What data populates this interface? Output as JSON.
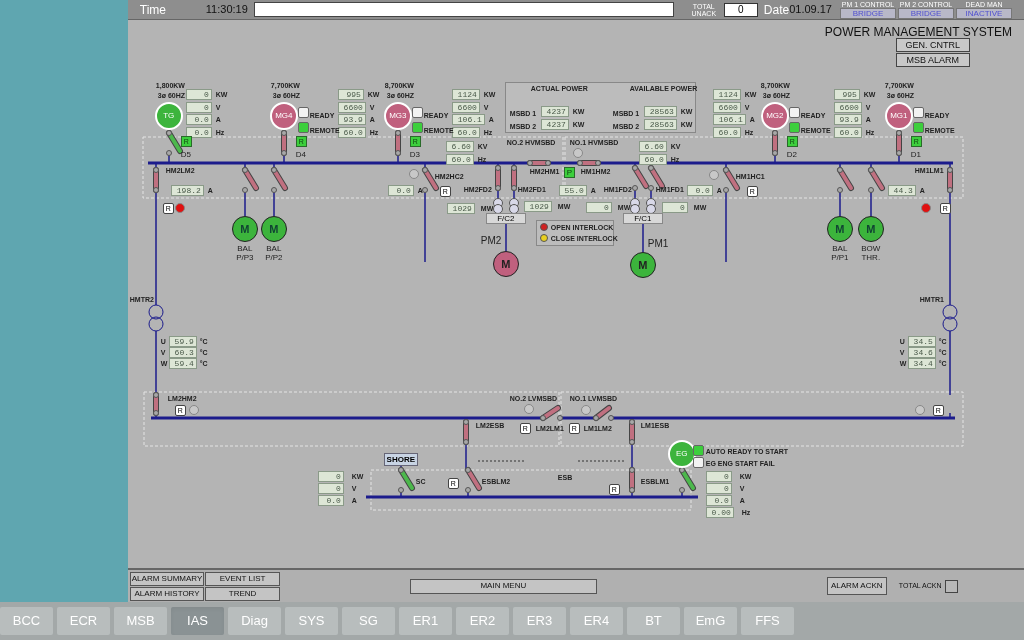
{
  "header": {
    "time_label": "Time",
    "time": "11:30:19",
    "unack_label": "TOTAL UNACK",
    "unack_count": "0",
    "date_label": "Date",
    "date": "01.09.17",
    "controls": [
      {
        "label": "PM 1 CONTROL",
        "value": "BRIDGE"
      },
      {
        "label": "PM 2 CONTROL",
        "value": "BRIDGE"
      },
      {
        "label": "DEAD MAN",
        "value": "INACTIVE"
      }
    ]
  },
  "title": "POWER MANAGEMENT SYSTEM",
  "top_buttons": [
    "GEN. CNTRL",
    "MSB ALARM"
  ],
  "generators": [
    {
      "name": "TG",
      "rating": "1,800KW",
      "spec": "3ø 60HZ",
      "color": "#3cb43c",
      "readings": [
        {
          "value": "0",
          "unit": "KW"
        },
        {
          "value": "0",
          "unit": "V"
        },
        {
          "value": "0.0",
          "unit": "A"
        },
        {
          "value": "0.0",
          "unit": "Hz"
        }
      ],
      "mode": "R",
      "breaker": {
        "label": "D5",
        "closed": false,
        "color": "#4cb84c"
      }
    },
    {
      "name": "MG4",
      "rating": "7,700KW",
      "spec": "3ø 60HZ",
      "color": "#c0607e",
      "readings": [
        {
          "value": "995",
          "unit": "KW"
        },
        {
          "value": "6600",
          "unit": "V"
        },
        {
          "value": "93.9",
          "unit": "A"
        },
        {
          "value": "60.0",
          "unit": "Hz"
        }
      ],
      "status": [
        {
          "label": "READY",
          "on": false
        },
        {
          "label": "REMOTE",
          "on": true
        }
      ],
      "mode": "R",
      "breaker": {
        "label": "D4",
        "closed": true,
        "color": "#c07080"
      }
    },
    {
      "name": "MG3",
      "rating": "8,700KW",
      "spec": "3ø 60HZ",
      "color": "#c0607e",
      "readings": [
        {
          "value": "1124",
          "unit": "KW"
        },
        {
          "value": "6600",
          "unit": "V"
        },
        {
          "value": "106.1",
          "unit": "A"
        },
        {
          "value": "60.0",
          "unit": "Hz"
        }
      ],
      "status": [
        {
          "label": "READY",
          "on": false
        },
        {
          "label": "REMOTE",
          "on": true
        }
      ],
      "mode": "R",
      "breaker": {
        "label": "D3",
        "closed": true,
        "color": "#c07080"
      }
    },
    {
      "name": "MG2",
      "rating": "8,700KW",
      "spec": "3ø 60HZ",
      "color": "#c0607e",
      "readings": [
        {
          "value": "1124",
          "unit": "KW"
        },
        {
          "value": "6600",
          "unit": "V"
        },
        {
          "value": "106.1",
          "unit": "A"
        },
        {
          "value": "60.0",
          "unit": "Hz"
        }
      ],
      "status": [
        {
          "label": "READY",
          "on": false
        },
        {
          "label": "REMOTE",
          "on": true
        }
      ],
      "mode": "R",
      "breaker": {
        "label": "D2",
        "closed": true,
        "color": "#c07080"
      }
    },
    {
      "name": "MG1",
      "rating": "7,700KW",
      "spec": "3ø 60HZ",
      "color": "#c0607e",
      "readings": [
        {
          "value": "995",
          "unit": "KW"
        },
        {
          "value": "6600",
          "unit": "V"
        },
        {
          "value": "93.9",
          "unit": "A"
        },
        {
          "value": "60.0",
          "unit": "Hz"
        }
      ],
      "status": [
        {
          "label": "READY",
          "on": false
        },
        {
          "label": "REMOTE",
          "on": true
        }
      ],
      "mode": "R",
      "breaker": {
        "label": "D1",
        "closed": true,
        "color": "#c07080"
      }
    }
  ],
  "power_summary": {
    "actual_title": "ACTUAL POWER",
    "available_title": "AVAILABLE POWER",
    "actual": [
      {
        "label": "MSBD 1",
        "value": "4237",
        "unit": "KW"
      },
      {
        "label": "MSBD 2",
        "value": "4237",
        "unit": "KW"
      }
    ],
    "available": [
      {
        "label": "MSBD 1",
        "value": "28563",
        "unit": "KW"
      },
      {
        "label": "MSBD 2",
        "value": "28563",
        "unit": "KW"
      }
    ]
  },
  "hv_boards": [
    {
      "name": "NO.2 HVMSBD",
      "readings": [
        {
          "value": "6.60",
          "unit": "KV"
        },
        {
          "value": "60.0",
          "unit": "Hz"
        }
      ]
    },
    {
      "name": "NO.1 HVMSBD",
      "readings": [
        {
          "value": "6.60",
          "unit": "KV"
        },
        {
          "value": "60.0",
          "unit": "Hz"
        }
      ]
    }
  ],
  "bus_tie_mode": "P",
  "breakers": [
    {
      "label": "HM2LM2",
      "closed": true,
      "color": "#c07080"
    },
    {
      "label": "HM2HC2",
      "closed": false,
      "color": "#c07080"
    },
    {
      "label": "HM2FD2",
      "closed": true,
      "color": "#c07080"
    },
    {
      "label": "HM2FD1",
      "closed": true,
      "color": "#c07080"
    },
    {
      "label": "HM2HM1",
      "closed": true,
      "color": "#c07080"
    },
    {
      "label": "HM1HM2",
      "closed": true,
      "color": "#c07080"
    },
    {
      "label": "HM1FD2",
      "closed": false,
      "color": "#c07080"
    },
    {
      "label": "HM1FD1",
      "closed": false,
      "color": "#c07080"
    },
    {
      "label": "HM1HC1",
      "closed": false,
      "color": "#c07080"
    },
    {
      "label": "HM1LM1",
      "closed": true,
      "color": "#c07080"
    },
    {
      "label": "LM2HM2",
      "closed": true,
      "color": "#c07080"
    },
    {
      "label": "LM2LM1",
      "closed": false,
      "color": "#c07080"
    },
    {
      "label": "LM1LM2",
      "closed": false,
      "color": "#c07080"
    },
    {
      "label": "LM2ESB",
      "closed": true,
      "color": "#c07080"
    },
    {
      "label": "LM1ESB",
      "closed": true,
      "color": "#c07080"
    },
    {
      "label": "SC",
      "closed": false,
      "color": "#4cb84c"
    },
    {
      "label": "ESBLM2",
      "closed": false,
      "color": "#c07080"
    },
    {
      "label": "ESBLM1",
      "closed": true,
      "color": "#c07080"
    }
  ],
  "currents": [
    {
      "value": "198.2",
      "unit": "A"
    },
    {
      "value": "0.0",
      "unit": "A"
    },
    {
      "value": "55.0",
      "unit": "A"
    },
    {
      "value": "0.0",
      "unit": "A"
    },
    {
      "value": "44.3",
      "unit": "A"
    }
  ],
  "loads": [
    {
      "label": "BAL P/P3",
      "symbol": "M",
      "color": "#3cb43c",
      "closed": false
    },
    {
      "label": "BAL P/P2",
      "symbol": "M",
      "color": "#3cb43c",
      "closed": false
    },
    {
      "label": "BAL P/P1",
      "symbol": "M",
      "color": "#3cb43c",
      "closed": false
    },
    {
      "label": "BOW THR.",
      "symbol": "M",
      "color": "#3cb43c",
      "closed": false
    }
  ],
  "propulsion": [
    {
      "name": "PM2",
      "converter": "F/C2",
      "symbol": "M",
      "color": "#c0607e",
      "power": [
        {
          "value": "1029",
          "unit": "MW"
        },
        {
          "value": "1029",
          "unit": "MW"
        }
      ]
    },
    {
      "name": "PM1",
      "converter": "F/C1",
      "symbol": "M",
      "color": "#3cb43c",
      "power": [
        {
          "value": "0",
          "unit": "MW"
        },
        {
          "value": "0",
          "unit": "MW"
        }
      ]
    }
  ],
  "interlocks": [
    {
      "label": "OPEN INTERLOCK",
      "color": "#d02020"
    },
    {
      "label": "CLOSE INTERLOCK",
      "color": "#e8d020"
    }
  ],
  "lamps": [
    {
      "color": "#c8c8c8"
    },
    {
      "color": "#c8c8c8"
    },
    {
      "color": "#c8c8c8"
    },
    {
      "color": "#e01010"
    },
    {
      "color": "#e01010"
    },
    {
      "color": "#c8c8c8"
    },
    {
      "color": "#c8c8c8"
    },
    {
      "color": "#c8c8c8"
    },
    {
      "color": "#c8c8c8"
    }
  ],
  "reset_buttons": [
    "R",
    "R",
    "R",
    "R",
    "R",
    "R",
    "R",
    "R",
    "R",
    "R"
  ],
  "transformers": [
    {
      "name": "HMTR2",
      "temps": [
        {
          "phase": "U",
          "value": "59.9",
          "unit": "°C"
        },
        {
          "phase": "V",
          "value": "60.3",
          "unit": "°C"
        },
        {
          "phase": "W",
          "value": "59.4",
          "unit": "°C"
        }
      ]
    },
    {
      "name": "HMTR1",
      "temps": [
        {
          "phase": "U",
          "value": "34.5",
          "unit": "°C"
        },
        {
          "phase": "V",
          "value": "34.6",
          "unit": "°C"
        },
        {
          "phase": "W",
          "value": "34.4",
          "unit": "°C"
        }
      ]
    }
  ],
  "lv_boards": [
    "NO.2 LVMSBD",
    "NO.1 LVMSBD"
  ],
  "esb": {
    "name": "ESB",
    "shore_button": "SHORE",
    "shore_readings": [
      {
        "value": "0",
        "unit": "KW"
      },
      {
        "value": "0",
        "unit": "V"
      },
      {
        "value": "0.0",
        "unit": "A"
      }
    ]
  },
  "eg": {
    "name": "EG",
    "color": "#3cb43c",
    "breaker_closed": false,
    "status": [
      {
        "label": "AUTO READY TO START",
        "on": true
      },
      {
        "label": "EG ENG START FAIL",
        "on": false
      }
    ],
    "readings": [
      {
        "value": "0",
        "unit": "KW"
      },
      {
        "value": "0",
        "unit": "V"
      },
      {
        "value": "0.0",
        "unit": "A"
      },
      {
        "value": "0.00",
        "unit": "Hz"
      }
    ]
  },
  "bottom": {
    "alarm_buttons": [
      "ALARM SUMMARY",
      "EVENT LIST",
      "ALARM HISTORY",
      "TREND"
    ],
    "main_menu": "MAIN MENU",
    "alarm_ackn": "ALARM ACKN",
    "total_ackn": {
      "label": "TOTAL ACKN",
      "checked": false
    }
  },
  "tabs": [
    {
      "label": "BCC",
      "selected": false
    },
    {
      "label": "ECR",
      "selected": false
    },
    {
      "label": "MSB",
      "selected": false
    },
    {
      "label": "IAS",
      "selected": true
    },
    {
      "label": "Diag",
      "selected": false
    },
    {
      "label": "SYS",
      "selected": false
    },
    {
      "label": "SG",
      "selected": false
    },
    {
      "label": "ER1",
      "selected": false
    },
    {
      "label": "ER2",
      "selected": false
    },
    {
      "label": "ER3",
      "selected": false
    },
    {
      "label": "ER4",
      "selected": false
    },
    {
      "label": "BT",
      "selected": false
    },
    {
      "label": "EmG",
      "selected": false
    },
    {
      "label": "FFS",
      "selected": false
    }
  ]
}
